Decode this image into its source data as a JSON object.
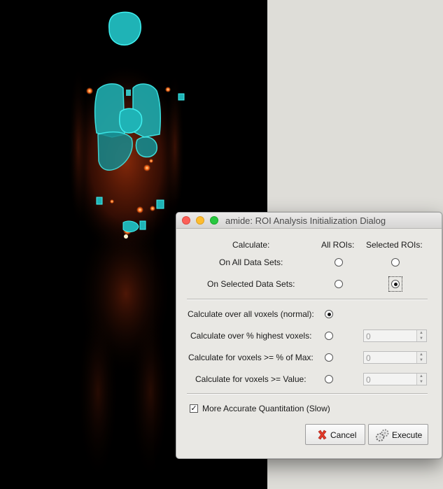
{
  "dialog": {
    "title": "amide: ROI Analysis Initialization Dialog",
    "calculate_header": "Calculate:",
    "col_all_rois": "All ROIs:",
    "col_selected_rois": "Selected ROIs:",
    "row_all_data_sets": "On All Data Sets:",
    "row_selected_data_sets": "On Selected Data Sets:",
    "selected_option": "selected_data_sets_selected_rois",
    "voxel_options": [
      {
        "label": "Calculate over all voxels (normal):",
        "selected": true
      },
      {
        "label": "Calculate over % highest voxels:",
        "selected": false,
        "value": "0"
      },
      {
        "label": "Calculate for voxels >= % of Max:",
        "selected": false,
        "value": "0"
      },
      {
        "label": "Calculate for voxels >= Value:",
        "selected": false,
        "value": "0"
      }
    ],
    "accurate_quantitation": {
      "label": "More Accurate Quantitation (Slow)",
      "checked": true,
      "mark": "✓"
    },
    "cancel_label": "Cancel",
    "execute_label": "Execute"
  },
  "colors": {
    "roi_cyan": "#23c7c7",
    "pet_hot": "#ff5a1a",
    "viewer_bg": "#000000"
  },
  "icons": {
    "cancel": "red-x-icon",
    "execute": "gear-icon"
  }
}
